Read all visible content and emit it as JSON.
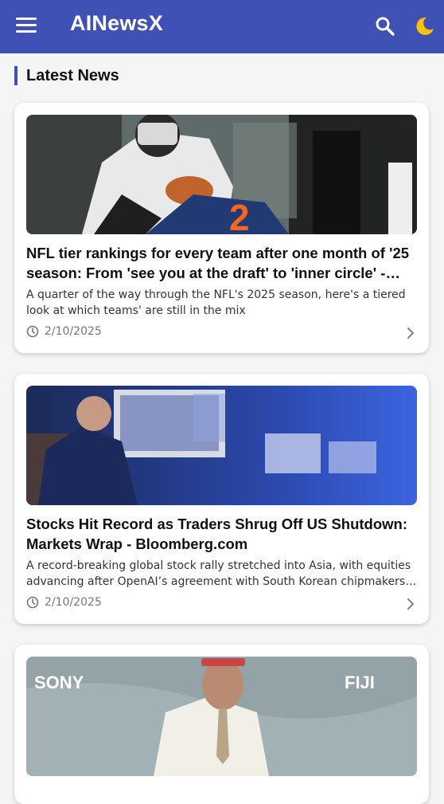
{
  "app": {
    "title": "AINewsX",
    "icons": [
      "menu-icon",
      "search-icon",
      "moon-icon"
    ],
    "accent": "#3f51b5",
    "moon_color": "#ffc107"
  },
  "section": {
    "title": "Latest News"
  },
  "articles": [
    {
      "title": "NFL tier rankings for every team after one month of '25 season: From 'see you at the draft' to 'inner circle' - CBS ...",
      "description": "A quarter of the way through the NFL's 2025 season, here's a tiered look at which teams' are still in the mix",
      "date": "2/10/2025",
      "image_label": "football-game-photo"
    },
    {
      "title": "Stocks Hit Record as Traders Shrug Off US Shutdown: Markets Wrap - Bloomberg.com",
      "description": "A record-breaking global stock rally stretched into Asia, with equities advancing after OpenAI’s agreement with South Korean chipmakers…",
      "date": "2/10/2025",
      "image_label": "stock-exchange-photo"
    },
    {
      "title": "",
      "description": "",
      "date": "",
      "image_label": "red-carpet-photo"
    }
  ]
}
